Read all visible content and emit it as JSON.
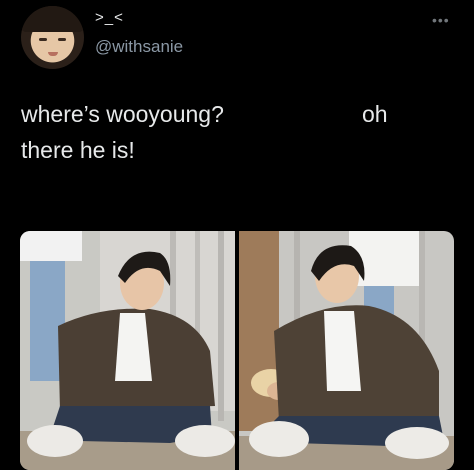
{
  "tweet": {
    "display_name": ">_<",
    "handle": "@withsanie",
    "line1_left": "where’s wooyoung?",
    "line1_right": "oh",
    "line2": "there he is!"
  },
  "icons": {
    "avatar": "avatar-face",
    "more": "more-horizontal-icon"
  },
  "colors": {
    "background": "#000000",
    "text_primary": "#e7e9ea",
    "text_secondary": "#8b98a5"
  }
}
